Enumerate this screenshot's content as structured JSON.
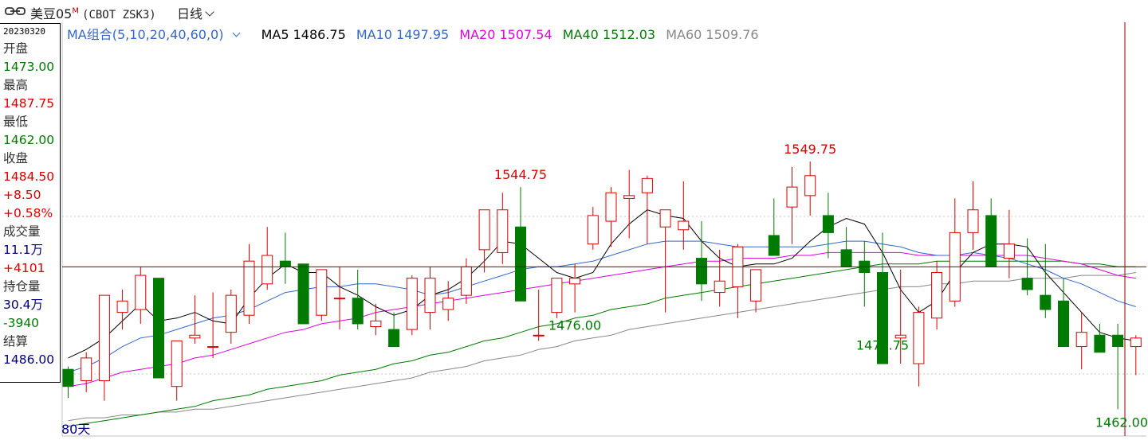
{
  "header": {
    "title": "美豆05",
    "badge": "M",
    "code": "(CBOT ZSK3)",
    "period": "日线",
    "link_icon": "link-icon"
  },
  "info": {
    "date": "20230320",
    "open_label": "开盘",
    "open": "1473.00",
    "high_label": "最高",
    "high": "1487.75",
    "low_label": "最低",
    "low": "1462.00",
    "close_label": "收盘",
    "close": "1484.50",
    "change": "+8.50",
    "change_pct": "+0.58%",
    "volume_label": "成交量",
    "volume": "11.1万",
    "volume_change": "+4101",
    "oi_label": "持仓量",
    "oi": "30.4万",
    "oi_change": "-3940",
    "settle_label": "结算",
    "settle": "1486.00"
  },
  "ma_legend": {
    "group": "MA组合(5,10,20,40,60,0)",
    "ma5": "MA5 1486.75",
    "ma10": "MA10 1497.95",
    "ma20": "MA20 1507.54",
    "ma40": "MA40 1512.03",
    "ma60": "MA60 1509.76"
  },
  "span_label": "80天",
  "annotations": [
    {
      "text": "1544.75",
      "kind": "high",
      "index": 25
    },
    {
      "text": "1549.75",
      "kind": "high",
      "index": 41
    },
    {
      "text": "1476.00",
      "kind": "low",
      "index": 28
    },
    {
      "text": "1477.75",
      "kind": "low",
      "index": 45
    },
    {
      "text": "1462.00",
      "kind": "low",
      "index": 58
    }
  ],
  "colors": {
    "up": "#d80000",
    "down": "#007a00",
    "ma5": "#000000",
    "ma10": "#3366cc",
    "ma20": "#dd00dd",
    "ma40": "#007a00",
    "ma60": "#888888",
    "crosshair": "#8b0000"
  },
  "chart_data": {
    "type": "candlestick",
    "ylim": [
      1455,
      1555
    ],
    "crosshair_price": 1512,
    "ohlc": [
      [
        1476,
        1477,
        1466,
        1470
      ],
      [
        1472,
        1482,
        1468,
        1480
      ],
      [
        1472,
        1502,
        1465,
        1502
      ],
      [
        1496,
        1504,
        1490,
        1500
      ],
      [
        1497,
        1512,
        1492,
        1509
      ],
      [
        1508,
        1508,
        1475,
        1473
      ],
      [
        1470,
        1486,
        1465,
        1486
      ],
      [
        1487,
        1502,
        1485,
        1488
      ],
      [
        1484,
        1503,
        1480,
        1484
      ],
      [
        1489,
        1504,
        1485,
        1502
      ],
      [
        1495,
        1520,
        1492,
        1514
      ],
      [
        1506,
        1526,
        1504,
        1516
      ],
      [
        1514,
        1524,
        1506,
        1512
      ],
      [
        1513,
        1510,
        1492,
        1492
      ],
      [
        1495,
        1511,
        1493,
        1511
      ],
      [
        1501,
        1512,
        1490,
        1501
      ],
      [
        1501,
        1511,
        1490,
        1492
      ],
      [
        1491,
        1499,
        1488,
        1493
      ],
      [
        1490,
        1496,
        1484,
        1484
      ],
      [
        1490,
        1509,
        1488,
        1508
      ],
      [
        1496,
        1512,
        1490,
        1508
      ],
      [
        1497,
        1507,
        1493,
        1501
      ],
      [
        1502,
        1515,
        1499,
        1512
      ],
      [
        1518,
        1532,
        1510,
        1532
      ],
      [
        1517,
        1538,
        1513,
        1532
      ],
      [
        1526,
        1540,
        1504,
        1500
      ],
      [
        1488,
        1504,
        1486,
        1488
      ],
      [
        1496,
        1506,
        1494,
        1508
      ],
      [
        1506,
        1513,
        1496,
        1508
      ],
      [
        1520,
        1533,
        1518,
        1530
      ],
      [
        1528,
        1540,
        1519,
        1538
      ],
      [
        1536,
        1546,
        1522,
        1537
      ],
      [
        1538,
        1544,
        1520,
        1543
      ],
      [
        1526,
        1526,
        1496,
        1532
      ],
      [
        1525,
        1542,
        1518,
        1528
      ],
      [
        1515,
        1528,
        1500,
        1506
      ],
      [
        1503,
        1518,
        1498,
        1507
      ],
      [
        1505,
        1520,
        1494,
        1519
      ],
      [
        1500,
        1510,
        1496,
        1511
      ],
      [
        1523,
        1536,
        1516,
        1516
      ],
      [
        1533,
        1547,
        1520,
        1540
      ],
      [
        1537,
        1549,
        1530,
        1544
      ],
      [
        1530,
        1538,
        1515,
        1524
      ],
      [
        1518,
        1526,
        1512,
        1512
      ],
      [
        1514,
        1521,
        1498,
        1510
      ],
      [
        1510,
        1524,
        1489,
        1478
      ],
      [
        1487,
        1511,
        1478,
        1488
      ],
      [
        1478,
        1498,
        1470,
        1496
      ],
      [
        1494,
        1514,
        1490,
        1510
      ],
      [
        1500,
        1536,
        1498,
        1524
      ],
      [
        1524,
        1542,
        1518,
        1532
      ],
      [
        1530,
        1536,
        1518,
        1512
      ],
      [
        1515,
        1532,
        1508,
        1520
      ],
      [
        1508,
        1522,
        1502,
        1504
      ],
      [
        1502,
        1520,
        1494,
        1497
      ],
      [
        1500,
        1508,
        1484,
        1484
      ],
      [
        1484,
        1496,
        1476,
        1489
      ],
      [
        1488,
        1492,
        1482,
        1482
      ],
      [
        1488,
        1492,
        1462,
        1484
      ],
      [
        1484,
        1488,
        1474,
        1487
      ]
    ],
    "ma5": [
      1480,
      1483,
      1487,
      1493,
      1499,
      1493,
      1494,
      1496,
      1493,
      1492,
      1501,
      1508,
      1513,
      1510,
      1510,
      1505,
      1502,
      1498,
      1495,
      1497,
      1502,
      1504,
      1508,
      1514,
      1521,
      1520,
      1515,
      1510,
      1508,
      1510,
      1520,
      1527,
      1532,
      1530,
      1529,
      1521,
      1515,
      1512,
      1513,
      1513,
      1515,
      1521,
      1526,
      1529,
      1527,
      1517,
      1504,
      1496,
      1500,
      1510,
      1517,
      1520,
      1520,
      1519,
      1510,
      1503,
      1496,
      1489,
      1487,
      1486
    ],
    "ma10": [
      1475,
      1477,
      1480,
      1484,
      1487,
      1488,
      1490,
      1492,
      1494,
      1495,
      1497,
      1500,
      1503,
      1504,
      1505,
      1505,
      1506,
      1506,
      1505,
      1504,
      1502,
      1503,
      1505,
      1507,
      1509,
      1511,
      1512,
      1512,
      1513,
      1514,
      1516,
      1518,
      1520,
      1521,
      1521,
      1521,
      1520,
      1519,
      1519,
      1519,
      1519,
      1519,
      1520,
      1521,
      1521,
      1520,
      1519,
      1517,
      1516,
      1516,
      1517,
      1516,
      1515,
      1513,
      1511,
      1508,
      1506,
      1503,
      1500,
      1498
    ],
    "ma20": [
      1470,
      1471,
      1473,
      1475,
      1476,
      1477,
      1478,
      1480,
      1481,
      1483,
      1485,
      1487,
      1489,
      1490,
      1492,
      1493,
      1494,
      1496,
      1497,
      1498,
      1499,
      1500,
      1501,
      1502,
      1503,
      1504,
      1505,
      1506,
      1507,
      1508,
      1509,
      1510,
      1511,
      1512,
      1513,
      1514,
      1514,
      1515,
      1515,
      1515,
      1516,
      1516,
      1517,
      1517,
      1517,
      1517,
      1517,
      1516,
      1516,
      1516,
      1516,
      1516,
      1516,
      1516,
      1515,
      1514,
      1513,
      1511,
      1509,
      1508
    ],
    "ma40": [
      1456,
      1457,
      1458,
      1459,
      1460,
      1461,
      1462,
      1463,
      1465,
      1466,
      1467,
      1469,
      1470,
      1471,
      1472,
      1474,
      1475,
      1476,
      1478,
      1479,
      1481,
      1482,
      1484,
      1486,
      1487,
      1489,
      1491,
      1492,
      1494,
      1495,
      1497,
      1498,
      1499,
      1501,
      1502,
      1503,
      1504,
      1505,
      1506,
      1507,
      1508,
      1509,
      1510,
      1511,
      1512,
      1513,
      1513,
      1513,
      1514,
      1514,
      1514,
      1514,
      1514,
      1514,
      1514,
      1514,
      1513,
      1513,
      1512,
      1512
    ],
    "ma60": [
      1458,
      1459,
      1459,
      1460,
      1460,
      1461,
      1461,
      1462,
      1462,
      1463,
      1464,
      1465,
      1466,
      1467,
      1468,
      1469,
      1470,
      1471,
      1472,
      1473,
      1475,
      1476,
      1477,
      1479,
      1480,
      1481,
      1483,
      1484,
      1486,
      1487,
      1488,
      1490,
      1491,
      1492,
      1493,
      1494,
      1495,
      1496,
      1497,
      1498,
      1499,
      1500,
      1501,
      1502,
      1503,
      1504,
      1505,
      1505,
      1506,
      1506,
      1507,
      1507,
      1507,
      1508,
      1508,
      1508,
      1509,
      1509,
      1509,
      1510
    ]
  }
}
